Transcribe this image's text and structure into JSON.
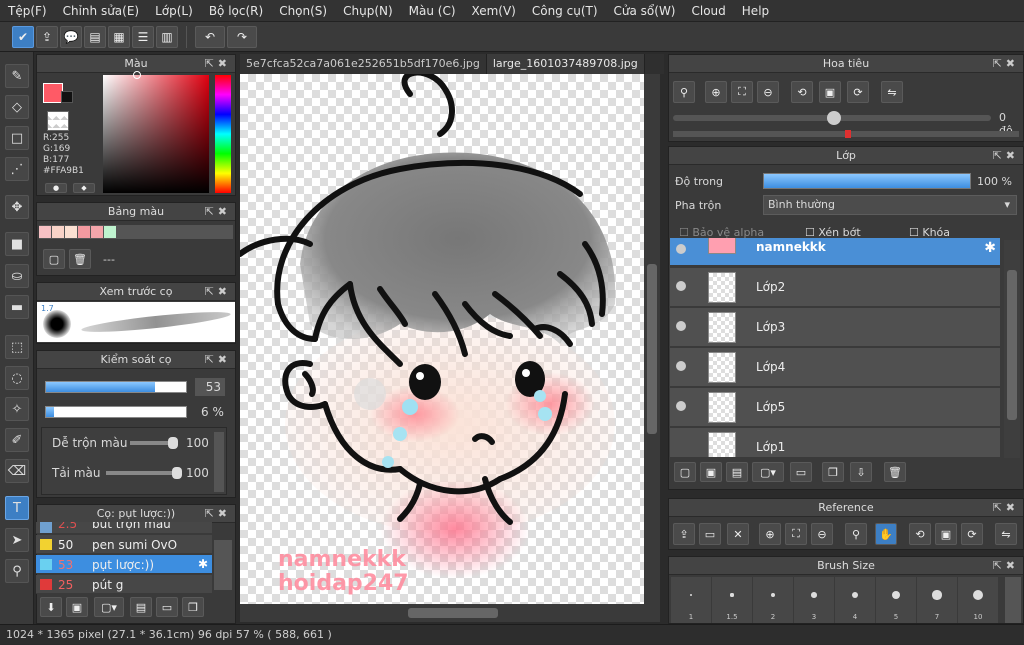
{
  "menu": [
    "Tệp(F)",
    "Chỉnh sửa(E)",
    "Lớp(L)",
    "Bộ lọc(R)",
    "Chọn(S)",
    "Chụp(N)",
    "Màu (C)",
    "Xem(V)",
    "Công cụ(T)",
    "Cửa sổ(W)",
    "Cloud",
    "Help"
  ],
  "tabs": [
    "5e7cfca52ca7a061e252651b5df170e6.jpg",
    "large_1601037489708.jpg"
  ],
  "color_panel": {
    "title": "Màu",
    "r": "R:255",
    "g": "G:169",
    "b": "B:177",
    "hex": "#FFA9B1",
    "fg_color": "#ff5a66"
  },
  "palette_panel": {
    "title": "Bảng màu",
    "value": "---",
    "swatches": [
      "#f7c1c4",
      "#f9d3c8",
      "#fbe0d2",
      "#f39aa0",
      "#f4a6ab",
      "#bff3cf"
    ]
  },
  "preview_panel": {
    "title": "Xem trước cọ",
    "size_label": "1.7"
  },
  "brush_control": {
    "title": "Kiểm soát cọ",
    "size": "53",
    "opacity": "6 %",
    "mix_label": "Dễ trộn màu",
    "mix_value": "100",
    "load_label": "Tải màu",
    "load_value": "100",
    "size_fraction": 0.78,
    "opacity_fraction": 0.06
  },
  "brush_list": {
    "title": "Cọ: pụt lược:))",
    "items": [
      {
        "num": "2.5",
        "name": "bút trộn màu",
        "color": "#6fa0d0"
      },
      {
        "num": "50",
        "name": "pen sumi OvO",
        "color": "#f2d230"
      },
      {
        "num": "53",
        "name": "pụt lược:))",
        "color": "#6ad0f0"
      },
      {
        "num": "25",
        "name": "pút g",
        "color": "#e03a3a"
      }
    ]
  },
  "navigator": {
    "title": "Hoa tiêu",
    "angle": "0 độ"
  },
  "layers": {
    "title": "Lớp",
    "opacity_label": "Độ trong",
    "opacity_value": "100 %",
    "blend_label": "Pha trộn",
    "blend_value": "Bình thường",
    "protect_alpha": "Bảo vệ alpha",
    "clipping": "Xén bớt",
    "lock": "Khóa",
    "items": [
      "namnekkk",
      "Lớp2",
      "Lớp3",
      "Lớp4",
      "Lớp5",
      "Lớp1"
    ]
  },
  "reference": {
    "title": "Reference"
  },
  "brush_size": {
    "title": "Brush Size",
    "sizes": [
      "1",
      "1.5",
      "2",
      "3",
      "4",
      "5",
      "7",
      "10"
    ]
  },
  "canvas": {
    "watermark1": "namnekkk",
    "watermark2": "hoidap247"
  },
  "status": "1024 * 1365 pixel  (27.1 * 36.1cm)  96 dpi  57 %  ( 588, 661 )"
}
